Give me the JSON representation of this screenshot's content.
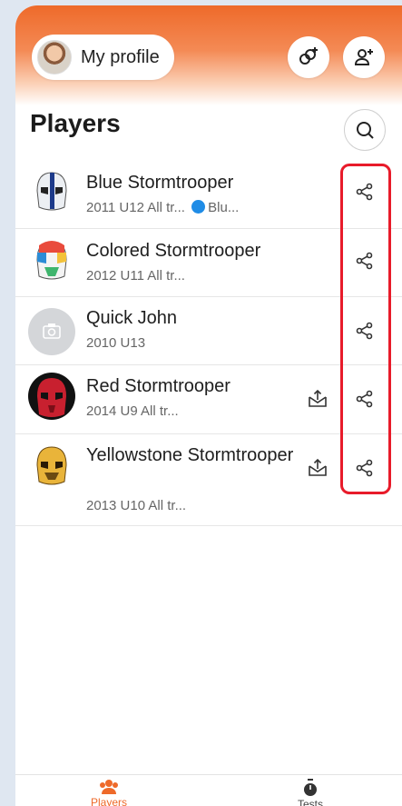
{
  "header": {
    "profile_label": "My profile"
  },
  "page": {
    "title": "Players"
  },
  "players": [
    {
      "name": "Blue Stormtrooper",
      "meta": "2011 U12 All tr...",
      "extra": "Blu...",
      "share": true,
      "upload": false
    },
    {
      "name": "Colored Stormtrooper",
      "meta": "2012 U11 All tr...",
      "share": true,
      "upload": false
    },
    {
      "name": "Quick John",
      "meta": "2010 U13",
      "share": true,
      "upload": false
    },
    {
      "name": "Red Stormtrooper",
      "meta": "2014 U9 All tr...",
      "share": true,
      "upload": true
    },
    {
      "name": "Yellowstone Stormtrooper",
      "meta": "2013 U10 All tr...",
      "share": true,
      "upload": true
    }
  ],
  "nav": {
    "players_label": "Players",
    "tests_label": "Tests"
  },
  "colors": {
    "accent": "#ee6a2a",
    "highlight": "#e81b2a",
    "team_dot": "#1f8ce6"
  }
}
